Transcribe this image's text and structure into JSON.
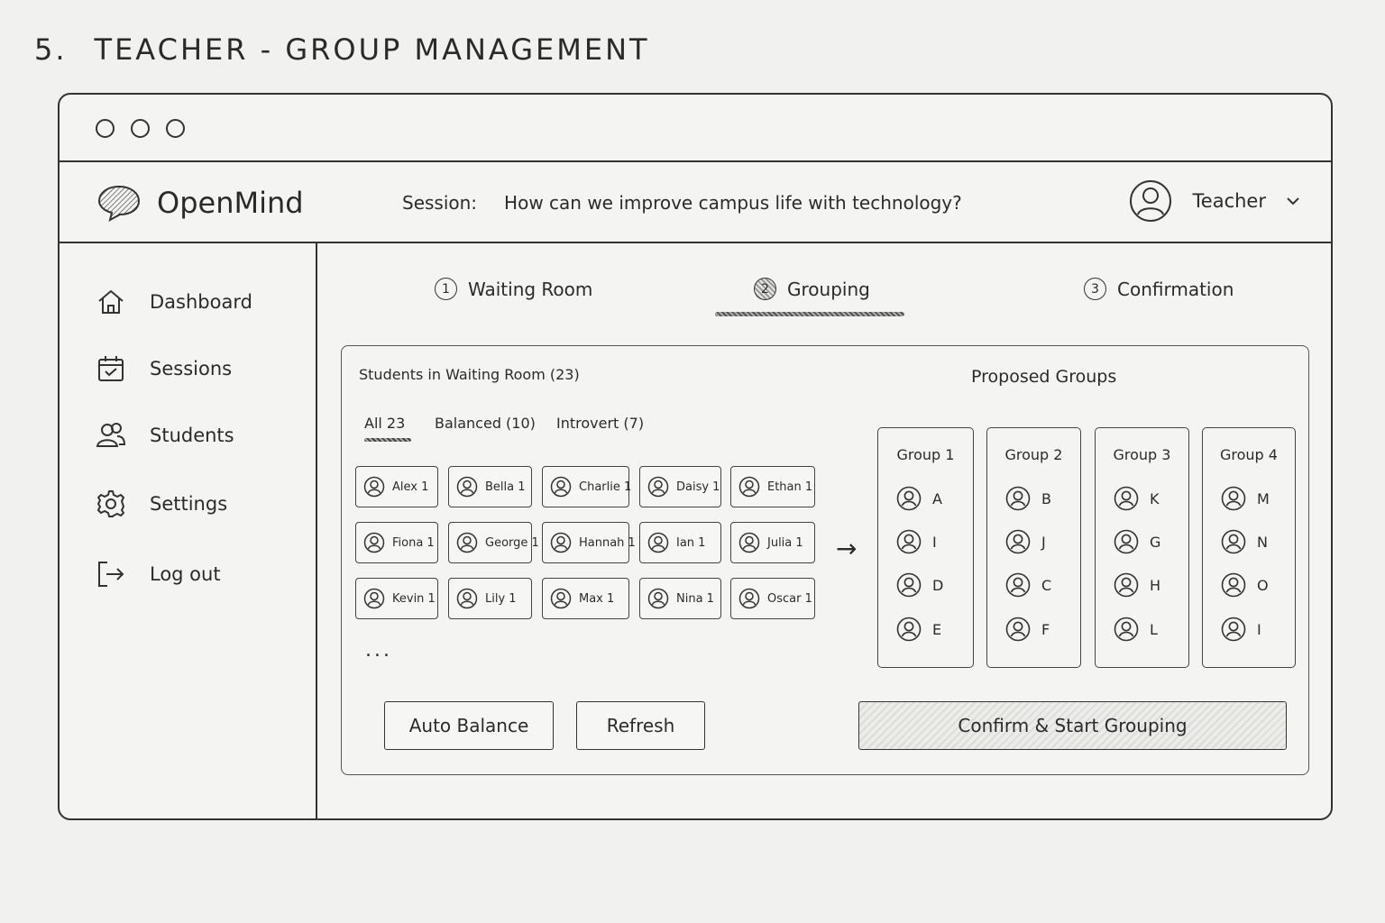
{
  "page": {
    "number": "5.",
    "title": "TEACHER - GROUP MANAGEMENT"
  },
  "app": {
    "name": "OpenMind",
    "logo_icon": "speech-bubble-icon"
  },
  "session": {
    "label": "Session:",
    "question": "How can we improve campus life with technology?"
  },
  "user": {
    "name": "Teacher"
  },
  "sidebar": {
    "items": [
      {
        "label": "Dashboard",
        "icon": "home-icon"
      },
      {
        "label": "Sessions",
        "icon": "calendar-check-icon"
      },
      {
        "label": "Students",
        "icon": "users-icon"
      },
      {
        "label": "Settings",
        "icon": "gear-icon"
      },
      {
        "label": "Log out",
        "icon": "logout-icon"
      }
    ]
  },
  "steps": [
    {
      "num": "1",
      "label": "Waiting Room",
      "active": false
    },
    {
      "num": "2",
      "label": "Grouping",
      "active": true
    },
    {
      "num": "3",
      "label": "Confirmation",
      "active": false
    }
  ],
  "waiting_room": {
    "title": "Students in Waiting Room (23)",
    "filters": [
      {
        "label": "All 23",
        "active": true
      },
      {
        "label": "Balanced (10)",
        "active": false
      },
      {
        "label": "Introvert (7)",
        "active": false
      }
    ],
    "students": [
      "Alex 1",
      "Bella 1",
      "Charlie 1",
      "Daisy 1",
      "Ethan 1",
      "Fiona 1",
      "George 1",
      "Hannah 1",
      "Ian 1",
      "Julia 1",
      "Kevin 1",
      "Lily 1",
      "Max 1",
      "Nina 1",
      "Oscar 1"
    ],
    "more": "...",
    "arrow": "→"
  },
  "proposed": {
    "title": "Proposed Groups",
    "groups": [
      {
        "name": "Group 1",
        "members": [
          "A",
          "I",
          "D",
          "E"
        ]
      },
      {
        "name": "Group 2",
        "members": [
          "B",
          "J",
          "C",
          "F"
        ]
      },
      {
        "name": "Group 3",
        "members": [
          "K",
          "G",
          "H",
          "L"
        ]
      },
      {
        "name": "Group 4",
        "members": [
          "M",
          "N",
          "O",
          "I"
        ]
      }
    ]
  },
  "actions": {
    "auto_balance": "Auto Balance",
    "refresh": "Refresh",
    "confirm": "Confirm & Start Grouping"
  }
}
